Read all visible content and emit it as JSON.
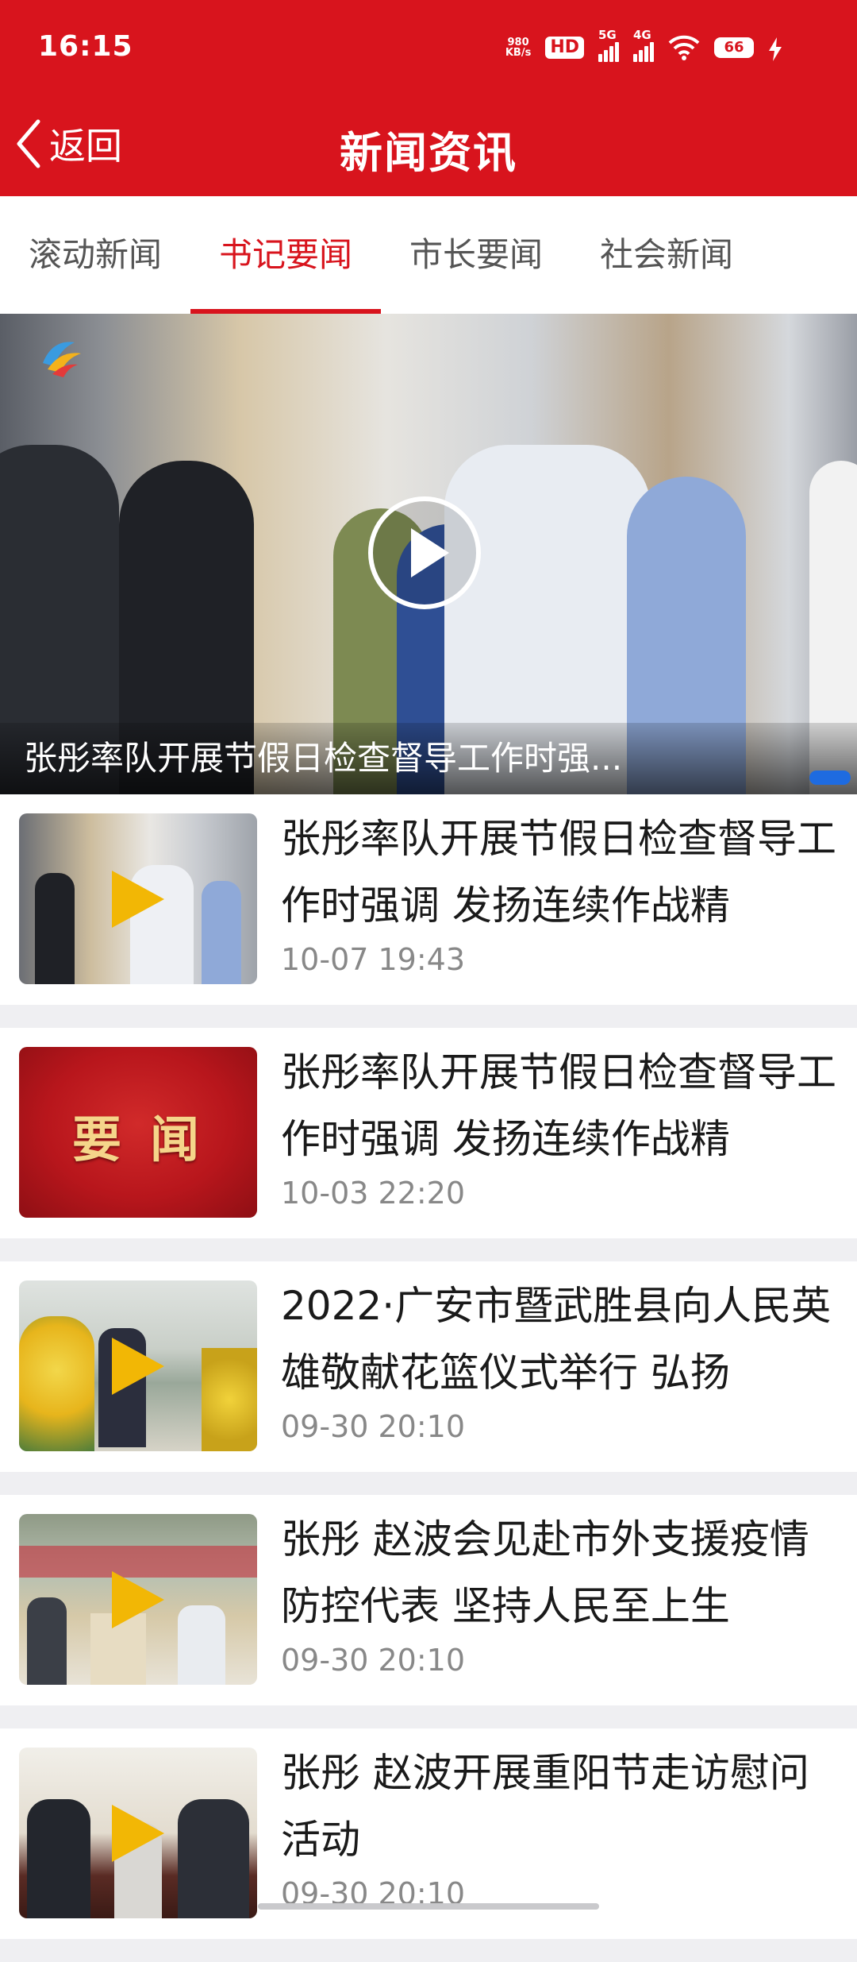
{
  "status_bar": {
    "time": "16:15",
    "net_speed_value": "980",
    "net_speed_unit": "KB/s",
    "hd_label": "HD",
    "signal1_label": "5G",
    "signal2_label": "4G",
    "battery_level": "66"
  },
  "header": {
    "back_label": "返回",
    "title": "新闻资讯"
  },
  "tabs": [
    {
      "label": "滚动新闻",
      "active": false
    },
    {
      "label": "书记要闻",
      "active": true
    },
    {
      "label": "市长要闻",
      "active": false
    },
    {
      "label": "社会新闻",
      "active": false
    }
  ],
  "banner": {
    "caption": "张彤率队开展节假日检查督导工作时强..."
  },
  "news": [
    {
      "title": "张彤率队开展节假日检查督导工作时强调 发扬连续作战精",
      "date": "10-07 19:43",
      "has_video": true
    },
    {
      "title": "张彤率队开展节假日检查督导工作时强调 发扬连续作战精",
      "date": "10-03 22:20",
      "has_video": false,
      "thumb_text": "要闻"
    },
    {
      "title": "2022·广安市暨武胜县向人民英雄敬献花篮仪式举行 弘扬",
      "date": "09-30 20:10",
      "has_video": true
    },
    {
      "title": "张彤 赵波会见赴市外支援疫情防控代表 坚持人民至上生",
      "date": "09-30 20:10",
      "has_video": true
    },
    {
      "title": "张彤 赵波开展重阳节走访慰问活动",
      "date": "09-30 20:10",
      "has_video": true
    }
  ],
  "colors": {
    "brand": "#d8141d",
    "play": "#f2b705",
    "date": "#888888"
  }
}
